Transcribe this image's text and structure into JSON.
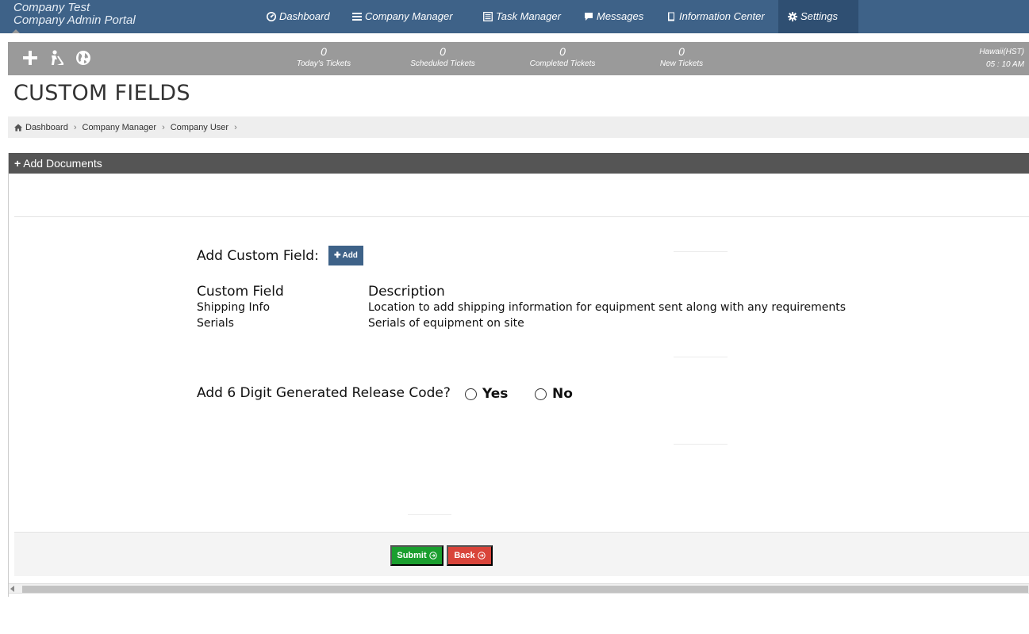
{
  "brand": {
    "line1": "Company Test",
    "line2": "Company Admin Portal"
  },
  "nav": {
    "items": [
      {
        "label": "Dashboard",
        "icon": "dashboard-icon"
      },
      {
        "label": "Company Manager",
        "icon": "list-icon"
      },
      {
        "label": "Task Manager",
        "icon": "tasks-icon"
      },
      {
        "label": "Messages",
        "icon": "chat-icon"
      },
      {
        "label": "Information Center",
        "icon": "book-icon"
      },
      {
        "label": "Settings",
        "icon": "gear-icon"
      }
    ],
    "active": "Settings"
  },
  "stats": {
    "todays": {
      "value": "0",
      "label": "Today's Tickets"
    },
    "scheduled": {
      "value": "0",
      "label": "Scheduled Tickets"
    },
    "completed": {
      "value": "0",
      "label": "Completed Tickets"
    },
    "new": {
      "value": "0",
      "label": "New Tickets"
    }
  },
  "timezone": {
    "name": "Hawaii(HST)",
    "time": "05 : 10  AM"
  },
  "page": {
    "title": "CUSTOM FIELDS"
  },
  "breadcrumb": [
    "Dashboard",
    "Company Manager",
    "Company User"
  ],
  "panel": {
    "header": "Add Documents",
    "add_custom_field_label": "Add Custom Field:",
    "add_button": "Add",
    "table": {
      "headers": [
        "Custom Field",
        "Description"
      ],
      "rows": [
        [
          "Shipping Info",
          "Location to add shipping information for equipment sent along with any requirements"
        ],
        [
          "Serials",
          "Serials of equipment on site"
        ]
      ]
    },
    "release_code_question": "Add 6 Digit Generated Release Code?",
    "yes": "Yes",
    "no": "No",
    "submit": "Submit",
    "back": "Back"
  },
  "colors": {
    "nav_bg": "#3e6288",
    "stats_bg": "#9a9a9a",
    "panel_header": "#555555",
    "submit": "#1a9e2e",
    "back": "#d9443a"
  }
}
